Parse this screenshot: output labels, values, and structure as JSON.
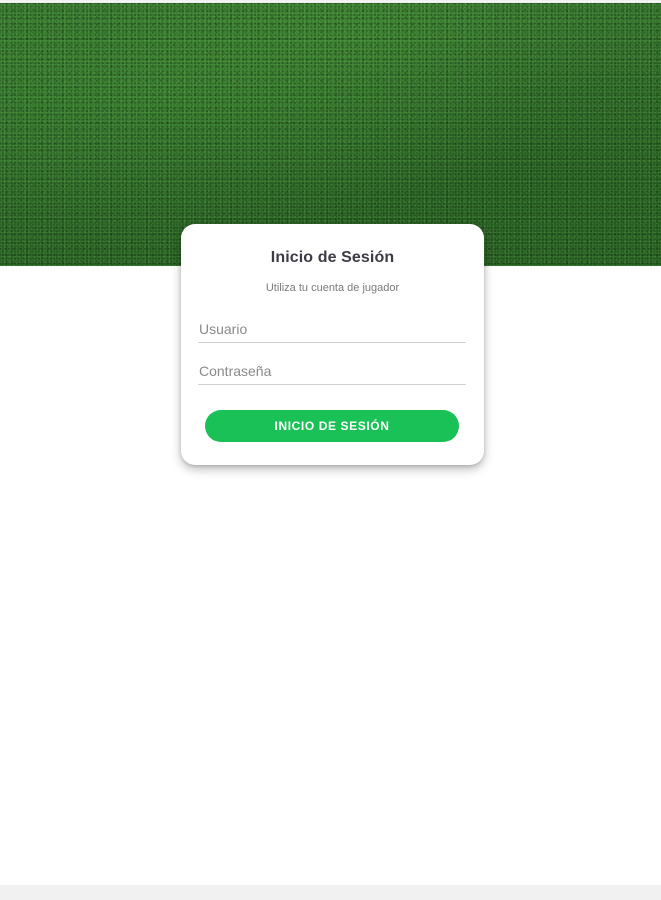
{
  "colors": {
    "accent": "#1ac156",
    "title_text": "#3b3b45",
    "grass": "#245e22"
  },
  "hero": {
    "image": "grass-field-background"
  },
  "login": {
    "title": "Inicio de Sesión",
    "subtitle": "Utiliza tu cuenta de jugador",
    "username": {
      "placeholder": "Usuario",
      "value": ""
    },
    "password": {
      "placeholder": "Contraseña",
      "value": ""
    },
    "submit_label": "INICIO DE SESIÓN"
  }
}
